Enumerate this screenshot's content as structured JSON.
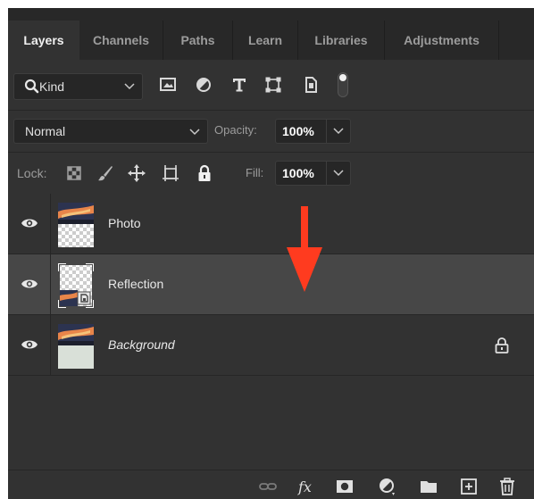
{
  "tabs": [
    {
      "label": "Layers",
      "active": true
    },
    {
      "label": "Channels",
      "active": false
    },
    {
      "label": "Paths",
      "active": false
    },
    {
      "label": "Learn",
      "active": false
    },
    {
      "label": "Libraries",
      "active": false
    },
    {
      "label": "Adjustments",
      "active": false
    }
  ],
  "filter": {
    "kind_label": "Kind",
    "icons": [
      "pixel-layer-filter-icon",
      "adjustment-layer-filter-icon",
      "type-layer-filter-icon",
      "shape-layer-filter-icon",
      "smart-object-filter-icon",
      "filter-toggle-icon"
    ]
  },
  "blend": {
    "mode": "Normal",
    "opacity_label": "Opacity:",
    "opacity_value": "100%"
  },
  "lock": {
    "label": "Lock:",
    "icons": [
      "lock-transparent-pixels-icon",
      "lock-image-pixels-icon",
      "lock-position-icon",
      "lock-artboard-icon",
      "lock-all-icon"
    ],
    "fill_label": "Fill:",
    "fill_value": "100%"
  },
  "layers": [
    {
      "name": "Photo",
      "visible": true,
      "selected": false,
      "italic": false,
      "locked": false
    },
    {
      "name": "Reflection",
      "visible": true,
      "selected": true,
      "italic": false,
      "locked": false,
      "smart_object": true
    },
    {
      "name": "Background",
      "visible": true,
      "selected": false,
      "italic": true,
      "locked": true
    }
  ],
  "toolbar": {
    "icons": [
      "link-layers-icon",
      "add-layer-style-icon",
      "add-mask-icon",
      "new-adjustment-layer-icon",
      "new-group-icon",
      "new-layer-icon",
      "delete-layer-icon"
    ],
    "fx_label": "fx"
  },
  "colors": {
    "panel_bg": "#323232",
    "tab_bar_bg": "#282828",
    "selected_row_bg": "#474747",
    "annotation_arrow": "#ff3b1f"
  }
}
